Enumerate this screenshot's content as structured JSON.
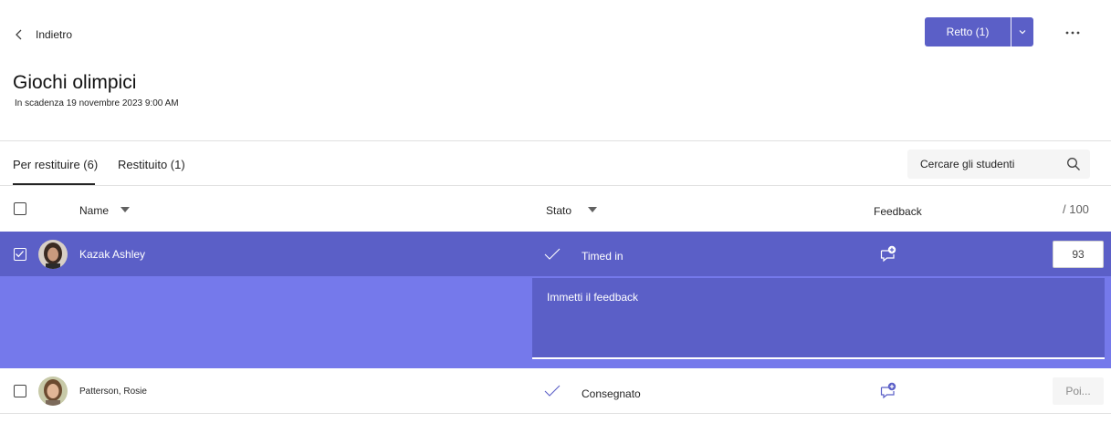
{
  "header": {
    "back_label": "Indietro",
    "return_button_label": "Retto (1)"
  },
  "assignment": {
    "title": "Giochi olimpici",
    "due": "In scadenza 19 novembre 2023 9:00 AM"
  },
  "tabs": [
    {
      "label": "Per restituire (6)",
      "active": true
    },
    {
      "label": "Restituito (1)",
      "active": false
    }
  ],
  "search": {
    "placeholder": "Cercare gli studenti"
  },
  "columns": {
    "name": "Name",
    "status": "Stato",
    "feedback": "Feedback",
    "points": "/ 100"
  },
  "students": [
    {
      "name": "Kazak Ashley",
      "status": "Timed in",
      "score": "93",
      "selected": true,
      "feedback_placeholder": "Immetti il feedback"
    },
    {
      "name": "Patterson, Rosie",
      "status": "Consegnato",
      "score_placeholder": "Poi...",
      "selected": false
    }
  ],
  "colors": {
    "accent": "#5b5fc7",
    "accent_light": "#7579eb",
    "text": "#242424"
  },
  "icons": {
    "back": "chevron-left-icon",
    "dropdown": "chevron-down-icon",
    "more": "more-horizontal-icon",
    "search": "search-icon",
    "status": "checkmark-icon",
    "feedback": "add-comment-icon",
    "sort": "caret-down-icon"
  }
}
